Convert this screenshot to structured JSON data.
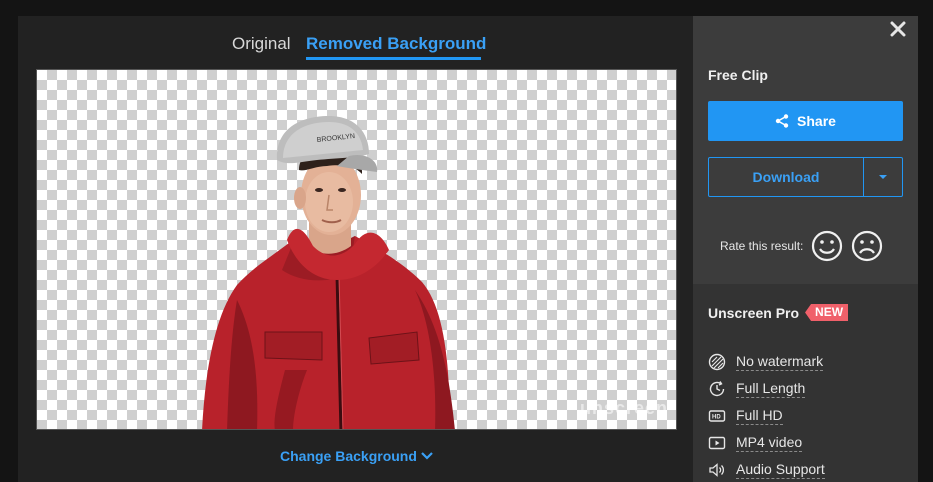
{
  "tabs": {
    "original": "Original",
    "removed": "Removed Background"
  },
  "preview": {
    "watermark": "unscreen",
    "change_background": "Change Background"
  },
  "sidebar": {
    "free_title": "Free Clip",
    "share_label": "Share",
    "download_label": "Download",
    "rate_label": "Rate this result:",
    "pro": {
      "title": "Unscreen Pro",
      "badge": "NEW",
      "features": [
        {
          "label": "No watermark",
          "icon": "no-watermark-icon"
        },
        {
          "label": "Full Length",
          "icon": "full-length-icon"
        },
        {
          "label": "Full HD",
          "icon": "hd-icon"
        },
        {
          "label": "MP4 video",
          "icon": "mp4-video-icon"
        },
        {
          "label": "Audio Support",
          "icon": "audio-icon"
        }
      ]
    }
  },
  "colors": {
    "accent": "#2196f3",
    "badge": "#f0606a",
    "sidebar_bg": "#3c3c3c",
    "modal_bg": "#222222"
  }
}
